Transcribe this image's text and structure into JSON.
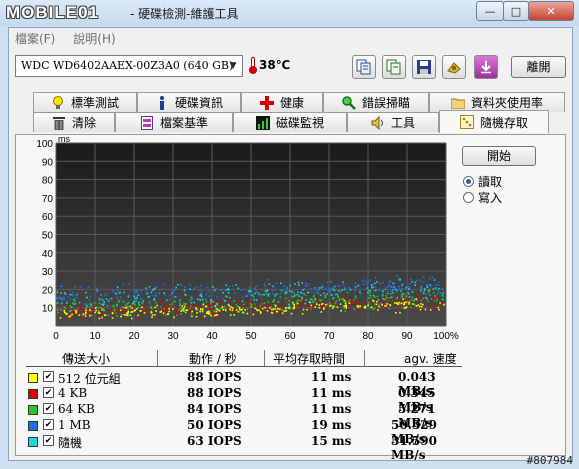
{
  "window": {
    "logo": "MOBILE01",
    "title": " - 硬碟檢測-維護工具",
    "controls": {
      "minimize": "—",
      "maximize": "□",
      "close": "✕"
    }
  },
  "menu": {
    "items": [
      {
        "label": "檔案(F)"
      },
      {
        "label": "說明(H)"
      }
    ]
  },
  "toolbar": {
    "drive": "WDC WD6402AAEX-00Z3A0 (640 GB)",
    "temperature": "38℃",
    "exit_label": "離開",
    "icons": [
      "copy-icon",
      "copy-text-icon",
      "save-icon",
      "options-icon",
      "download-icon"
    ]
  },
  "tabs": {
    "row1": [
      {
        "label": "標準測試",
        "icon": "bulb-icon"
      },
      {
        "label": "硬碟資訊",
        "icon": "info-icon"
      },
      {
        "label": "健康",
        "icon": "health-cross-icon"
      },
      {
        "label": "錯誤掃瞄",
        "icon": "magnifier-icon"
      },
      {
        "label": "資料夾使用率",
        "icon": "folder-icon"
      }
    ],
    "row2": [
      {
        "label": "清除",
        "icon": "trash-icon"
      },
      {
        "label": "檔案基準",
        "icon": "file-benchmark-icon"
      },
      {
        "label": "磁碟監視",
        "icon": "monitor-icon"
      },
      {
        "label": "工具",
        "icon": "speaker-tool-icon"
      },
      {
        "label": "隨機存取",
        "icon": "random-access-icon"
      }
    ]
  },
  "random_access": {
    "start_label": "開始",
    "mode_options": [
      {
        "label": "讀取",
        "selected": true
      },
      {
        "label": "寫入",
        "selected": false
      }
    ],
    "columns": {
      "size": "傳送大小",
      "ops": "動作 / 秒",
      "avg": "平均存取時間",
      "speed": "agv. 速度"
    },
    "rows": [
      {
        "label": "512 位元組",
        "color": "#ffff00",
        "checked": true,
        "iops": "88 IOPS",
        "avg": "11 ms",
        "speed": "0.043 MB/s"
      },
      {
        "label": "4 KB",
        "color": "#e00000",
        "checked": true,
        "iops": "88 IOPS",
        "avg": "11 ms",
        "speed": "0.345 MB/s"
      },
      {
        "label": "64 KB",
        "color": "#22cc22",
        "checked": true,
        "iops": "84 IOPS",
        "avg": "11 ms",
        "speed": "5.271 MB/s"
      },
      {
        "label": "1 MB",
        "color": "#1f6fe0",
        "checked": true,
        "iops": "50 IOPS",
        "avg": "19 ms",
        "speed": "50.329 MB/s"
      },
      {
        "label": "隨機",
        "color": "#19d9e6",
        "checked": true,
        "iops": "63 IOPS",
        "avg": "15 ms",
        "speed": "31.590 MB/s"
      }
    ]
  },
  "chart_data": {
    "type": "scatter",
    "ylabel": "ms",
    "x_ticks": [
      "0",
      "10",
      "20",
      "30",
      "40",
      "50",
      "60",
      "70",
      "80",
      "90",
      "100%"
    ],
    "y_ticks": [
      "100",
      "90",
      "80",
      "70",
      "60",
      "50",
      "40",
      "30",
      "20",
      "10"
    ],
    "xlim": [
      0,
      100
    ],
    "ylim": [
      0,
      100
    ],
    "grid": true,
    "series": [
      {
        "name": "512 位元組",
        "color": "#ffff00",
        "trend": {
          "start": [
            0,
            7
          ],
          "end": [
            100,
            12
          ]
        },
        "spread": 4
      },
      {
        "name": "4 KB",
        "color": "#e00000",
        "trend": {
          "start": [
            0,
            8
          ],
          "end": [
            100,
            14
          ]
        },
        "spread": 5
      },
      {
        "name": "64 KB",
        "color": "#22cc22",
        "trend": {
          "start": [
            0,
            9
          ],
          "end": [
            100,
            16
          ]
        },
        "spread": 6
      },
      {
        "name": "1 MB",
        "color": "#1f6fe0",
        "trend": {
          "start": [
            0,
            17
          ],
          "end": [
            100,
            23
          ]
        },
        "spread": 6
      },
      {
        "name": "隨機",
        "color": "#19d9e6",
        "trend": {
          "start": [
            0,
            14
          ],
          "end": [
            100,
            21
          ]
        },
        "spread": 7
      }
    ]
  },
  "watermark": "#807984"
}
